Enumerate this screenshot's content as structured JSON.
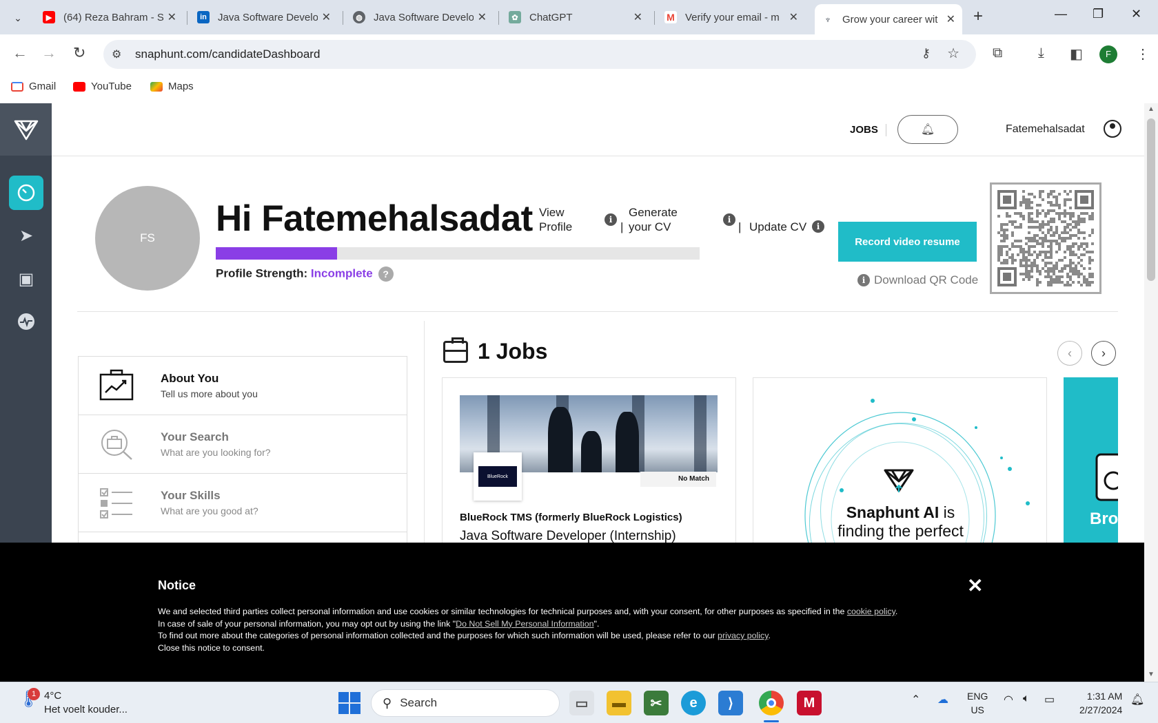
{
  "browser": {
    "tabs": [
      {
        "title": "(64) Reza Bahram - S",
        "icon": "youtube-icon",
        "color": "#ff0000"
      },
      {
        "title": "Java Software Develo",
        "icon": "linkedin-icon",
        "color": "#0a66c2"
      },
      {
        "title": "Java Software Develo",
        "icon": "globe-icon",
        "color": "#5f6368"
      },
      {
        "title": "ChatGPT",
        "icon": "chatgpt-icon",
        "color": "#74aa9c"
      },
      {
        "title": "Verify your email - m",
        "icon": "gmail-icon",
        "color": "#ea4335"
      },
      {
        "title": "Grow your career wit",
        "icon": "snaphunt-icon",
        "color": "#3b4450"
      }
    ],
    "url": "snaphunt.com/candidateDashboard",
    "profile_initial": "F",
    "bookmarks": [
      {
        "label": "Gmail",
        "icon": "gmail-icon"
      },
      {
        "label": "YouTube",
        "icon": "youtube-icon"
      },
      {
        "label": "Maps",
        "icon": "maps-icon"
      }
    ]
  },
  "site": {
    "nav": {
      "jobs": "JOBS",
      "username": "Fatemehalsadat"
    },
    "sidebar": [
      "dashboard-icon",
      "send-icon",
      "briefcase-icon",
      "activity-icon"
    ],
    "profile": {
      "initials": "FS",
      "greeting": "Hi Fatemehalsadat",
      "view_profile": "View Profile",
      "generate_cv": "Generate your CV",
      "update_cv": "Update CV",
      "strength_label": "Profile Strength:",
      "strength_value": "Incomplete",
      "strength_progress": 0.25,
      "record_button": "Record video resume",
      "download_qr": "Download QR Code"
    },
    "menu": [
      {
        "title": "About You",
        "subtitle": "Tell us more about you"
      },
      {
        "title": "Your Search",
        "subtitle": "What are you looking for?"
      },
      {
        "title": "Your Skills",
        "subtitle": "What are you good at?"
      }
    ],
    "jobs": {
      "heading": "1 Jobs",
      "card": {
        "badge": "No Match",
        "logo_text": "BlueRock",
        "company": "BlueRock TMS (formerly BlueRock Logistics)",
        "position": "Java Software Developer (Internship)"
      },
      "ai_card": {
        "bold": "Snaphunt AI",
        "text1": " is",
        "text2": "finding the perfect"
      },
      "partial_card": "Bro"
    }
  },
  "notice": {
    "title": "Notice",
    "line1_prefix": "We and selected third parties collect personal information and use cookies or similar technologies for technical purposes and, with your consent, for other purposes as specified in the ",
    "cookie_link": "cookie policy",
    "line1_suffix": ".",
    "line2_prefix": "In case of sale of your personal information, you may opt out by using the link \"",
    "dns_link": "Do Not Sell My Personal Information",
    "line2_suffix": "\".",
    "line3_prefix": "To find out more about the categories of personal information collected and the purposes for which such information will be used, please refer to our ",
    "privacy_link": "privacy policy",
    "line3_suffix": ".",
    "line4": "Close this notice to consent."
  },
  "taskbar": {
    "weather_badge": "1",
    "temperature": "4°C",
    "weather_text": "Het voelt kouder...",
    "search_placeholder": "Search",
    "lang1": "ENG",
    "lang2": "US",
    "time": "1:31 AM",
    "date": "2/27/2024"
  }
}
